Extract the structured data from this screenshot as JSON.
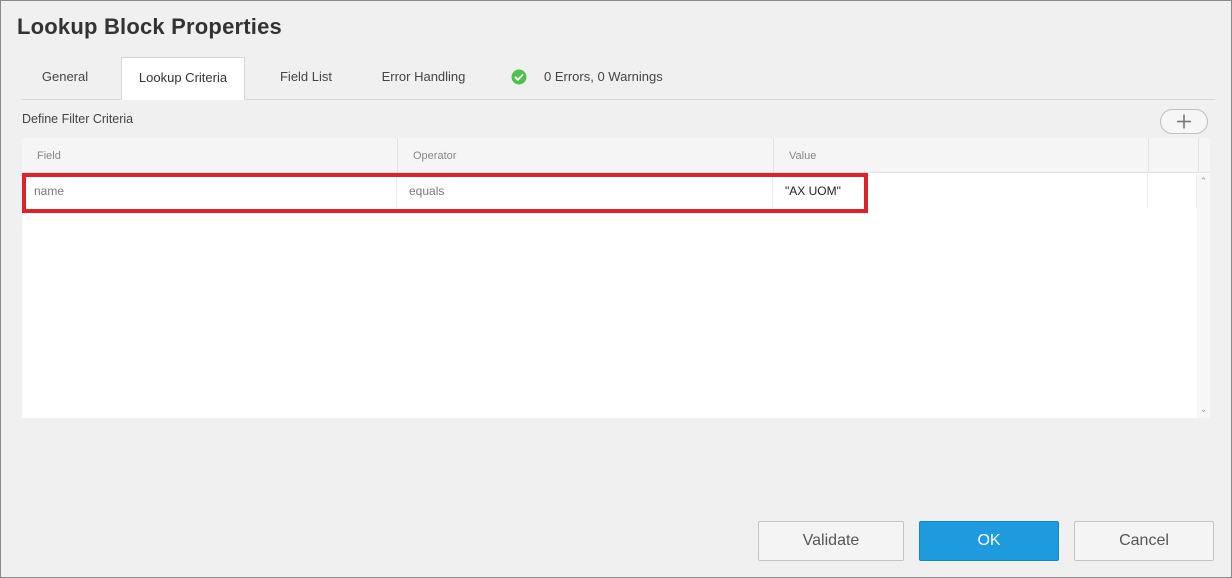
{
  "dialog": {
    "title": "Lookup Block Properties"
  },
  "tabs": [
    {
      "label": "General",
      "active": false
    },
    {
      "label": "Lookup Criteria",
      "active": true
    },
    {
      "label": "Field List",
      "active": false
    },
    {
      "label": "Error Handling",
      "active": false
    }
  ],
  "status": {
    "icon": "check-circle-icon",
    "text": "0 Errors, 0 Warnings",
    "color": "#4cc24c"
  },
  "filter": {
    "section_label": "Define Filter Criteria",
    "add_button_icon": "plus-icon",
    "columns": [
      "Field",
      "Operator",
      "Value"
    ],
    "rows": [
      {
        "field": "name",
        "operator": "equals",
        "value": "\"AX UOM\""
      }
    ],
    "highlight_color": "#e0202a"
  },
  "buttons": {
    "validate": "Validate",
    "ok": "OK",
    "cancel": "Cancel"
  },
  "colors": {
    "accent": "#1e9ade",
    "background": "#f0f0f0"
  }
}
